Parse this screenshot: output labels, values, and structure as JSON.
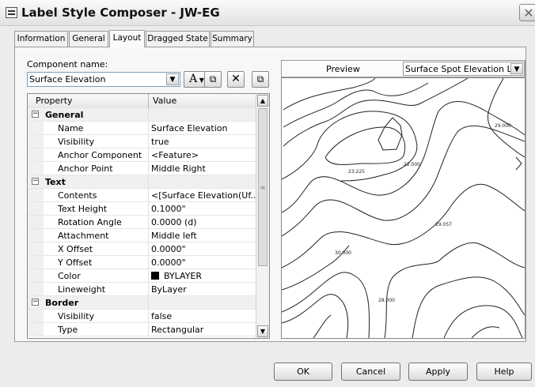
{
  "window": {
    "title": "Label Style Composer - JW-EG"
  },
  "tabs": [
    "Information",
    "General",
    "Layout",
    "Dragged State",
    "Summary"
  ],
  "component": {
    "label": "Component name:",
    "value": "Surface Elevation"
  },
  "grid": {
    "header_property": "Property",
    "header_value": "Value",
    "rows": [
      {
        "type": "cat",
        "property": "General",
        "value": ""
      },
      {
        "type": "item",
        "property": "Name",
        "value": "Surface Elevation"
      },
      {
        "type": "item",
        "property": "Visibility",
        "value": "true"
      },
      {
        "type": "item",
        "property": "Anchor Component",
        "value": "<Feature>"
      },
      {
        "type": "item",
        "property": "Anchor Point",
        "value": "Middle Right"
      },
      {
        "type": "cat",
        "property": "Text",
        "value": ""
      },
      {
        "type": "item",
        "property": "Contents",
        "value": "<[Surface Elevation(Uf..."
      },
      {
        "type": "item",
        "property": "Text Height",
        "value": "0.1000\""
      },
      {
        "type": "item",
        "property": "Rotation Angle",
        "value": "0.0000 (d)"
      },
      {
        "type": "item",
        "property": "Attachment",
        "value": "Middle left"
      },
      {
        "type": "item",
        "property": "X Offset",
        "value": "0.0000\""
      },
      {
        "type": "item",
        "property": "Y Offset",
        "value": "0.0000\""
      },
      {
        "type": "color",
        "property": "Color",
        "value": "BYLAYER"
      },
      {
        "type": "item",
        "property": "Lineweight",
        "value": "ByLayer"
      },
      {
        "type": "cat",
        "property": "Border",
        "value": ""
      },
      {
        "type": "item",
        "property": "Visibility",
        "value": "false"
      },
      {
        "type": "item",
        "property": "Type",
        "value": "Rectangular"
      }
    ]
  },
  "preview": {
    "label": "Preview",
    "style_value": "Surface Spot Elevation Lab",
    "contour_labels": [
      "29.000",
      "23.225",
      "22.000",
      "29.057",
      "30.000",
      "28.000"
    ]
  },
  "buttons": {
    "ok": "OK",
    "cancel": "Cancel",
    "apply": "Apply",
    "help": "Help"
  },
  "colors": {
    "swatch": "#000000"
  }
}
